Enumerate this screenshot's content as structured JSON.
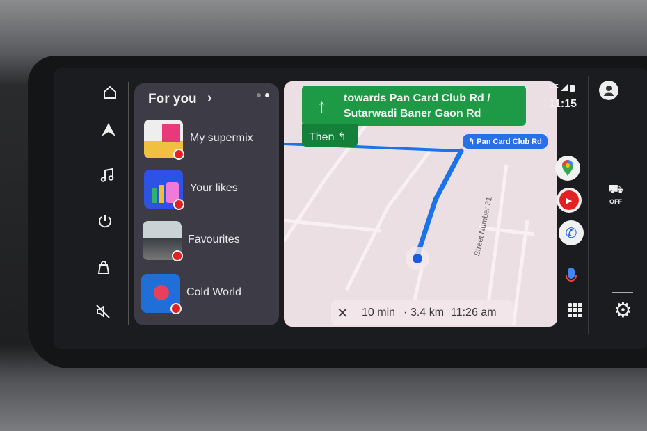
{
  "rail_left": {
    "icons": [
      "home-icon",
      "navigation-icon",
      "music-icon",
      "power-icon",
      "notification-bag-icon",
      "mute-icon"
    ]
  },
  "media": {
    "title": "For you",
    "items": [
      {
        "label": "My supermix"
      },
      {
        "label": "Your likes"
      },
      {
        "label": "Favourites"
      },
      {
        "label": "Cold World"
      }
    ]
  },
  "nav": {
    "direction_line1": "towards  Pan Card Club Rd /",
    "direction_line2": "Sutarwadi Baner Gaon Rd",
    "then_label": "Then",
    "next_street": "Pan Card Club Rd",
    "street_label": "Street Number 31",
    "eta_duration": "10 min",
    "eta_distance": "3.4 km",
    "eta_separator": "·",
    "eta_arrival": "11:26 am"
  },
  "status": {
    "network": "LTE",
    "time": "11:15"
  },
  "apps": [
    "google-maps",
    "youtube-music",
    "phone"
  ],
  "car_side": {
    "traction_label": "OFF"
  },
  "colors": {
    "route": "#1a73e8",
    "turn_card": "#1e9a46",
    "media_bg": "#3d3b45",
    "map_bg": "#ecdfe3"
  }
}
